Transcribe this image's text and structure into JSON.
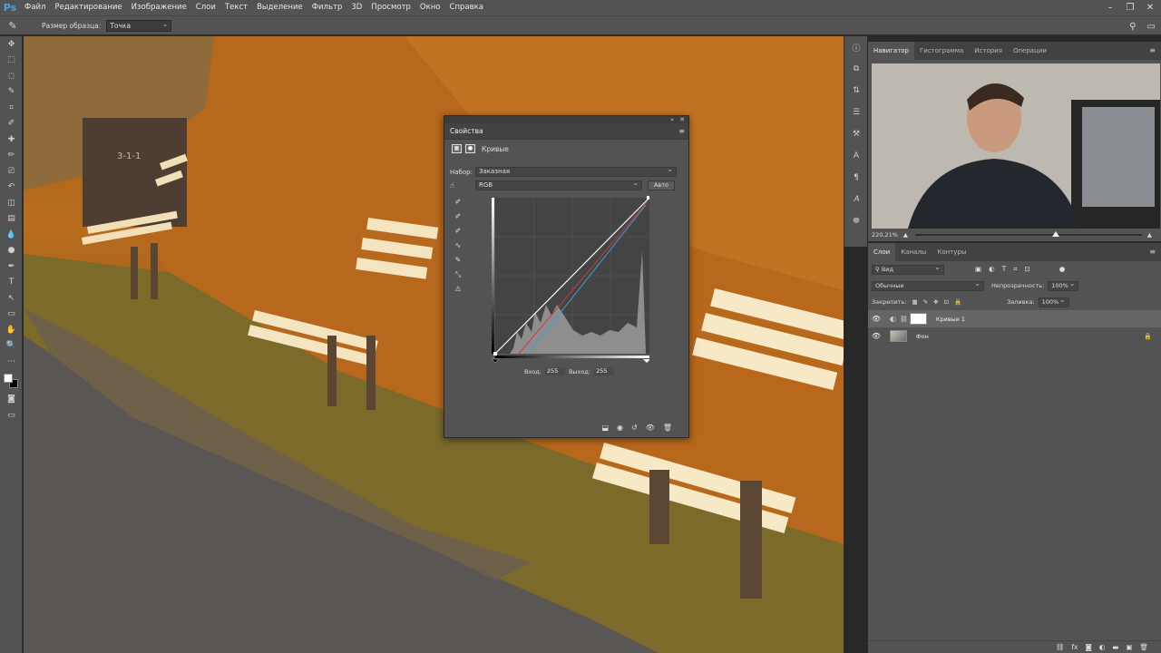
{
  "app": {
    "logo": "Ps"
  },
  "menu": [
    "Файл",
    "Редактирование",
    "Изображение",
    "Слои",
    "Текст",
    "Выделение",
    "Фильтр",
    "3D",
    "Просмотр",
    "Окно",
    "Справка"
  ],
  "window_controls": [
    "–",
    "❐",
    "✕"
  ],
  "options_bar": {
    "sample_size_label": "Размер образца:",
    "sample_size_value": "Точка"
  },
  "tools": [
    "move-tool",
    "marquee-tool",
    "lasso-tool",
    "quick-select-tool",
    "crop-tool",
    "eyedropper-tool",
    "healing-tool",
    "brush-tool",
    "stamp-tool",
    "history-brush-tool",
    "eraser-tool",
    "gradient-tool",
    "blur-tool",
    "dodge-tool",
    "pen-tool",
    "type-tool",
    "path-select-tool",
    "shape-tool",
    "hand-tool",
    "zoom-tool",
    "more-tools"
  ],
  "properties": {
    "tab": "Свойства",
    "title": "Кривые",
    "preset_label": "Набор:",
    "preset_value": "Заказная",
    "channel_value": "RGB",
    "auto_label": "Авто",
    "input_label": "Вход:",
    "input_value": "255",
    "output_label": "Выход:",
    "output_value": "255"
  },
  "navigator": {
    "tabs": [
      "Навигатор",
      "Гистограмма",
      "История",
      "Операции"
    ],
    "zoom": "220,21%",
    "zoom_fraction": 0.62
  },
  "layers": {
    "tabs": [
      "Слои",
      "Каналы",
      "Контуры"
    ],
    "filter_label": "Вид",
    "blend_mode": "Обычные",
    "opacity_label": "Непрозрачность:",
    "opacity_value": "100%",
    "lock_label": "Закрепить:",
    "fill_label": "Заливка:",
    "fill_value": "100%",
    "items": [
      {
        "name": "Кривые 1",
        "selected": true
      },
      {
        "name": "Фон",
        "selected": false
      }
    ]
  },
  "colors": {
    "accent_blue": "#4aa3df",
    "panel": "#535353",
    "dark": "#282828"
  }
}
